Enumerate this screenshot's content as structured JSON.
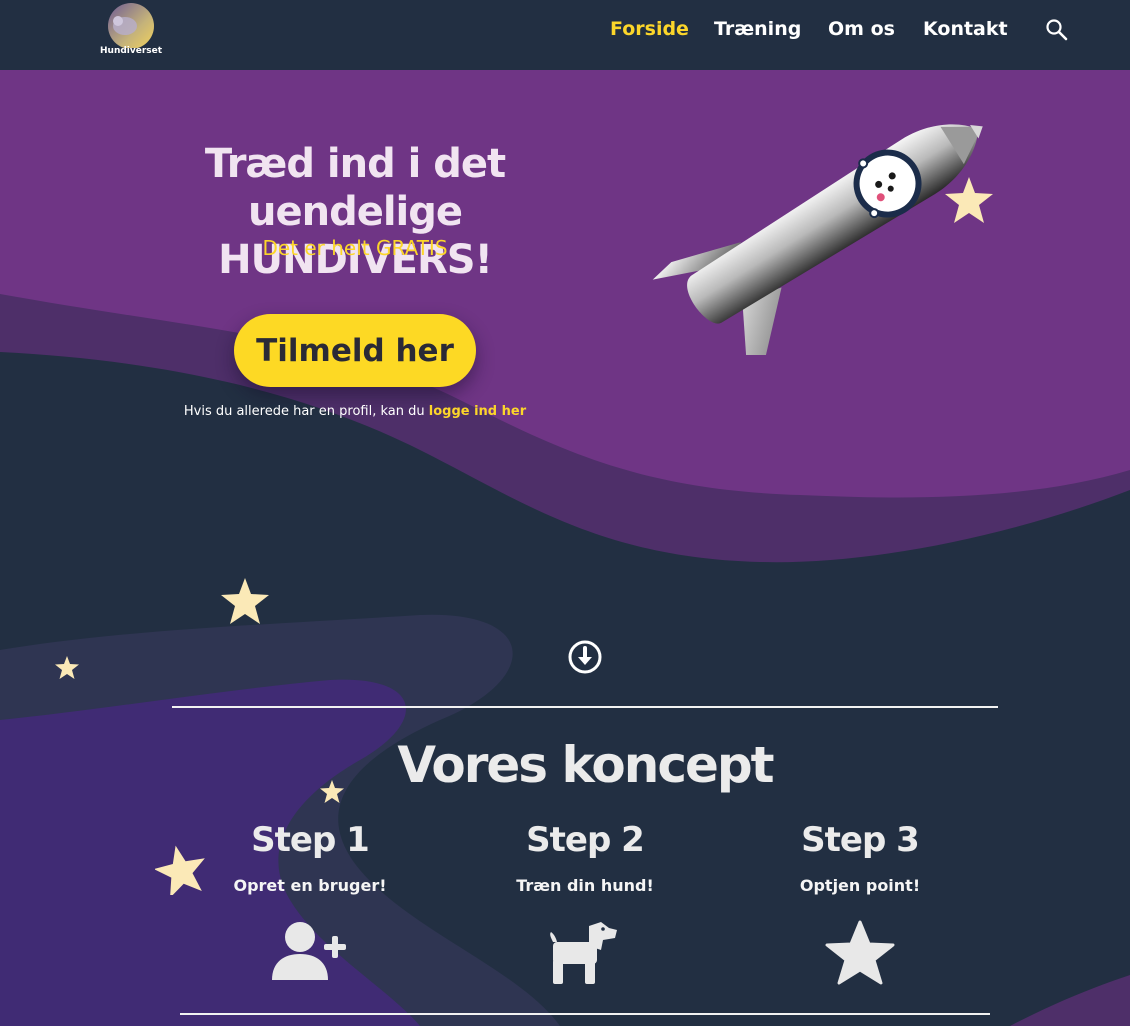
{
  "logo": {
    "text": "Hundiverset"
  },
  "nav": {
    "items": [
      {
        "label": "Forside",
        "active": true
      },
      {
        "label": "Træning",
        "active": false
      },
      {
        "label": "Om os",
        "active": false
      },
      {
        "label": "Kontakt",
        "active": false
      }
    ],
    "search_icon": "search-icon"
  },
  "hero": {
    "title_line1": "Træd ind i det uendelige",
    "title_line2": "HUNDIVERS!",
    "subtitle": "Det er helt GRATIS",
    "cta_label": "Tilmeld her",
    "login_prefix": "Hvis du allerede har en profil, kan du ",
    "login_link": "logge ind her"
  },
  "concept": {
    "title": "Vores koncept",
    "steps": [
      {
        "title": "Step 1",
        "text": "Opret en bruger!",
        "icon": "add-user-icon"
      },
      {
        "title": "Step 2",
        "text": "Træn din hund!",
        "icon": "dog-icon"
      },
      {
        "title": "Step 3",
        "text": "Optjen point!",
        "icon": "star-icon"
      }
    ]
  },
  "colors": {
    "background": "#222f42",
    "purple": "#6f3585",
    "accent_yellow": "#fcd62a",
    "star": "#fbe9b7"
  }
}
